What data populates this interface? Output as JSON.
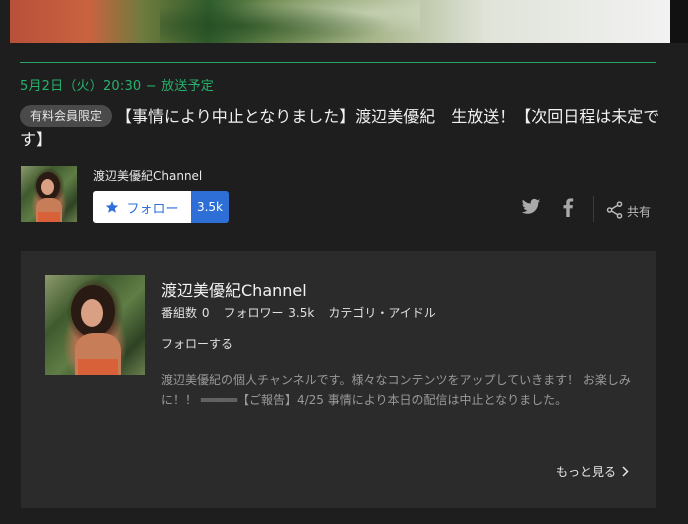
{
  "program": {
    "schedule": "5月2日（火）20:30 − 放送予定",
    "badge": "有料会員限定",
    "title": "【事情により中止となりました】渡辺美優紀　生放送！【次回日程は未定です】"
  },
  "channel": {
    "name": "渡辺美優紀Channel",
    "follow_label": "フォロー",
    "follow_count": "3.5k"
  },
  "share": {
    "label": "共有",
    "icons": [
      "twitter-icon",
      "facebook-icon",
      "share-icon"
    ]
  },
  "card": {
    "name": "渡辺美優紀Channel",
    "stats": [
      "番組数 0",
      "フォロワー 3.5k",
      "カテゴリ・アイドル"
    ],
    "follow_link": "フォローする",
    "description": "渡辺美優紀の個人チャンネルです。様々なコンテンツをアップしていきます！ お楽しみに！！ ═════【ご報告】4/25 事情により本日の配信は中止となりました。",
    "more_label": "もっと見る"
  },
  "colors": {
    "accent_green": "#26b36c",
    "follow_blue": "#2d6fd6",
    "background": "#1e1e1e",
    "card": "#2b2b2b"
  }
}
